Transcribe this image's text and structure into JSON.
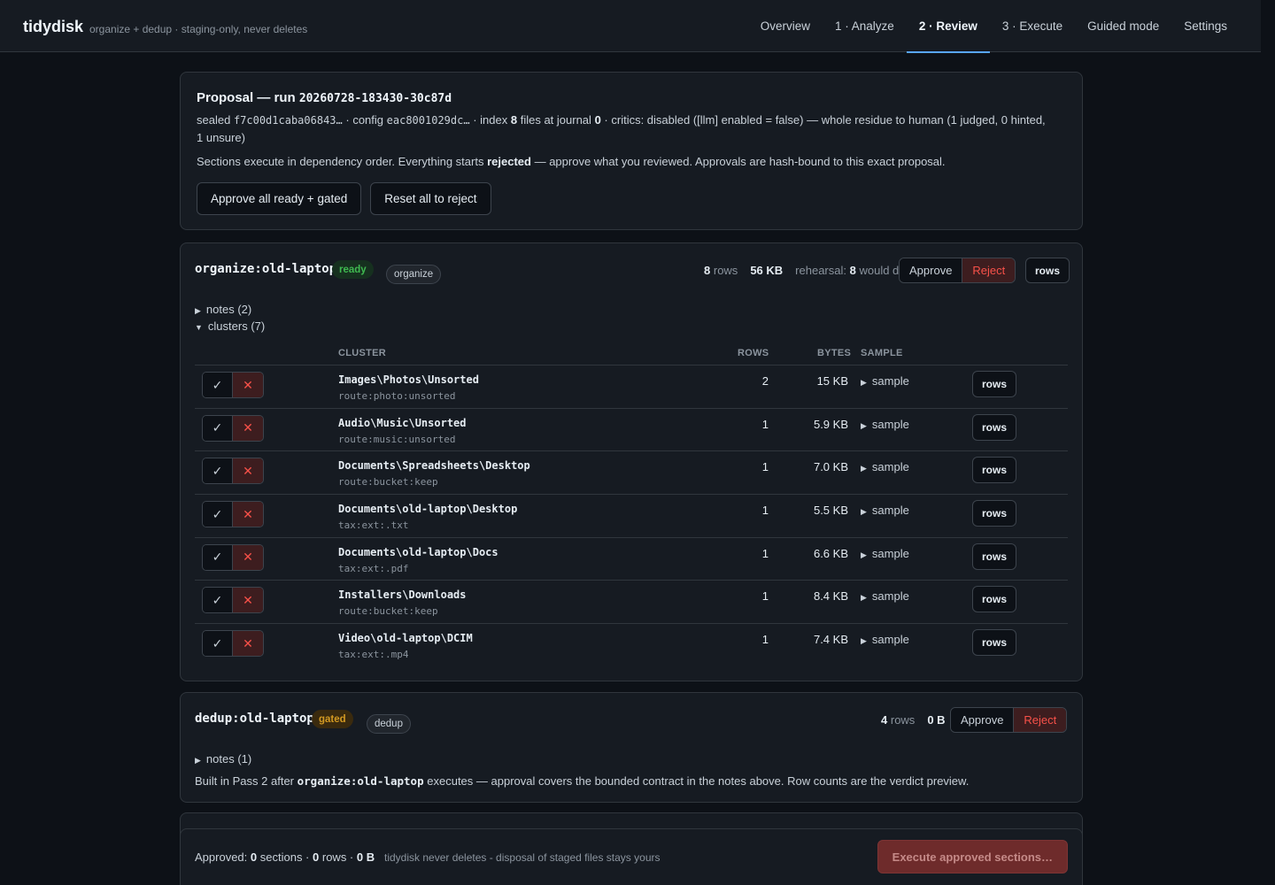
{
  "app": {
    "name": "tidydisk",
    "tagline": "organize + dedup · staging-only, never deletes"
  },
  "nav": [
    {
      "label": "Overview",
      "active": false
    },
    {
      "label": "1 · Analyze",
      "active": false
    },
    {
      "label": "2 · Review",
      "active": true
    },
    {
      "label": "3 · Execute",
      "active": false
    },
    {
      "label": "Guided mode",
      "active": false
    },
    {
      "label": "Settings",
      "active": false
    }
  ],
  "proposal": {
    "title_prefix": "Proposal — run",
    "run_id": "20260728-183430-30c87d",
    "sealed_label": "sealed",
    "sealed_hash": "f7c00d1caba06843…",
    "config_label": "· config",
    "config_hash": "eac8001029dc…",
    "index_text": "· index",
    "index_count": "8",
    "files_at_journal": "files at journal",
    "journal_count": "0",
    "critics_text": "· critics: disabled ([llm] enabled = false) — whole residue to human (1 judged, 0 hinted, 1 unsure)",
    "note_pre": "Sections execute in dependency order. Everything starts",
    "note_bold": "rejected",
    "note_post": "— approve what you reviewed. Approvals are hash-bound to this exact proposal.",
    "approve_all_label": "Approve all ready + gated",
    "reset_label": "Reset all to reject"
  },
  "sections": {
    "organize": {
      "name": "organize:old-laptop",
      "status": "ready",
      "kind": "organize",
      "rows_count": "8",
      "rows_unit": "rows",
      "bytes": "56 KB",
      "rehearsal_label": "rehearsal:",
      "rehearsal_count": "8",
      "rehearsal_suffix": "would do",
      "approve_label": "Approve",
      "reject_label": "Reject",
      "rows_button": "rows",
      "notes_label": "notes (2)",
      "clusters_label": "clusters (7)",
      "columns": {
        "cluster": "CLUSTER",
        "rows": "ROWS",
        "bytes": "BYTES",
        "sample": "SAMPLE"
      },
      "clusters": [
        {
          "path": "Images\\Photos\\Unsorted",
          "route": "route:photo:unsorted",
          "rows": "2",
          "bytes": "15 KB",
          "sample": "sample",
          "rows_button": "rows"
        },
        {
          "path": "Audio\\Music\\Unsorted",
          "route": "route:music:unsorted",
          "rows": "1",
          "bytes": "5.9 KB",
          "sample": "sample",
          "rows_button": "rows"
        },
        {
          "path": "Documents\\Spreadsheets\\Desktop",
          "route": "route:bucket:keep",
          "rows": "1",
          "bytes": "7.0 KB",
          "sample": "sample",
          "rows_button": "rows"
        },
        {
          "path": "Documents\\old-laptop\\Desktop",
          "route": "tax:ext:.txt",
          "rows": "1",
          "bytes": "5.5 KB",
          "sample": "sample",
          "rows_button": "rows"
        },
        {
          "path": "Documents\\old-laptop\\Docs",
          "route": "tax:ext:.pdf",
          "rows": "1",
          "bytes": "6.6 KB",
          "sample": "sample",
          "rows_button": "rows"
        },
        {
          "path": "Installers\\Downloads",
          "route": "route:bucket:keep",
          "rows": "1",
          "bytes": "8.4 KB",
          "sample": "sample",
          "rows_button": "rows"
        },
        {
          "path": "Video\\old-laptop\\DCIM",
          "route": "tax:ext:.mp4",
          "rows": "1",
          "bytes": "7.4 KB",
          "sample": "sample",
          "rows_button": "rows"
        }
      ]
    },
    "dedup": {
      "name": "dedup:old-laptop",
      "status": "gated",
      "kind": "dedup",
      "rows_count": "4",
      "rows_unit": "rows",
      "bytes": "0 B",
      "approve_label": "Approve",
      "reject_label": "Reject",
      "notes_label": "notes (1)",
      "built_pre": "Built in Pass 2 after",
      "built_ref": "organize:old-laptop",
      "built_post": "executes — approval covers the bounded contract in the notes above. Row counts are the verdict preview."
    }
  },
  "footer": {
    "approved_label": "Approved:",
    "sections_count": "0",
    "sections_label": "sections ·",
    "rows_count": "0",
    "rows_label": "rows ·",
    "bytes": "0 B",
    "note": "tidydisk never deletes - disposal of staged files stays yours",
    "execute_label": "Execute approved sections…"
  },
  "icons": {
    "check": "check-icon",
    "cross": "close-icon",
    "disclosure_closed": "triangle-right-icon",
    "disclosure_open": "triangle-down-icon"
  },
  "colors": {
    "background": "#0d1117",
    "panel": "#161b22",
    "accent": "#58a6ff",
    "ready": "#3fb950",
    "gated": "#d29922",
    "reject": "#f85149"
  }
}
